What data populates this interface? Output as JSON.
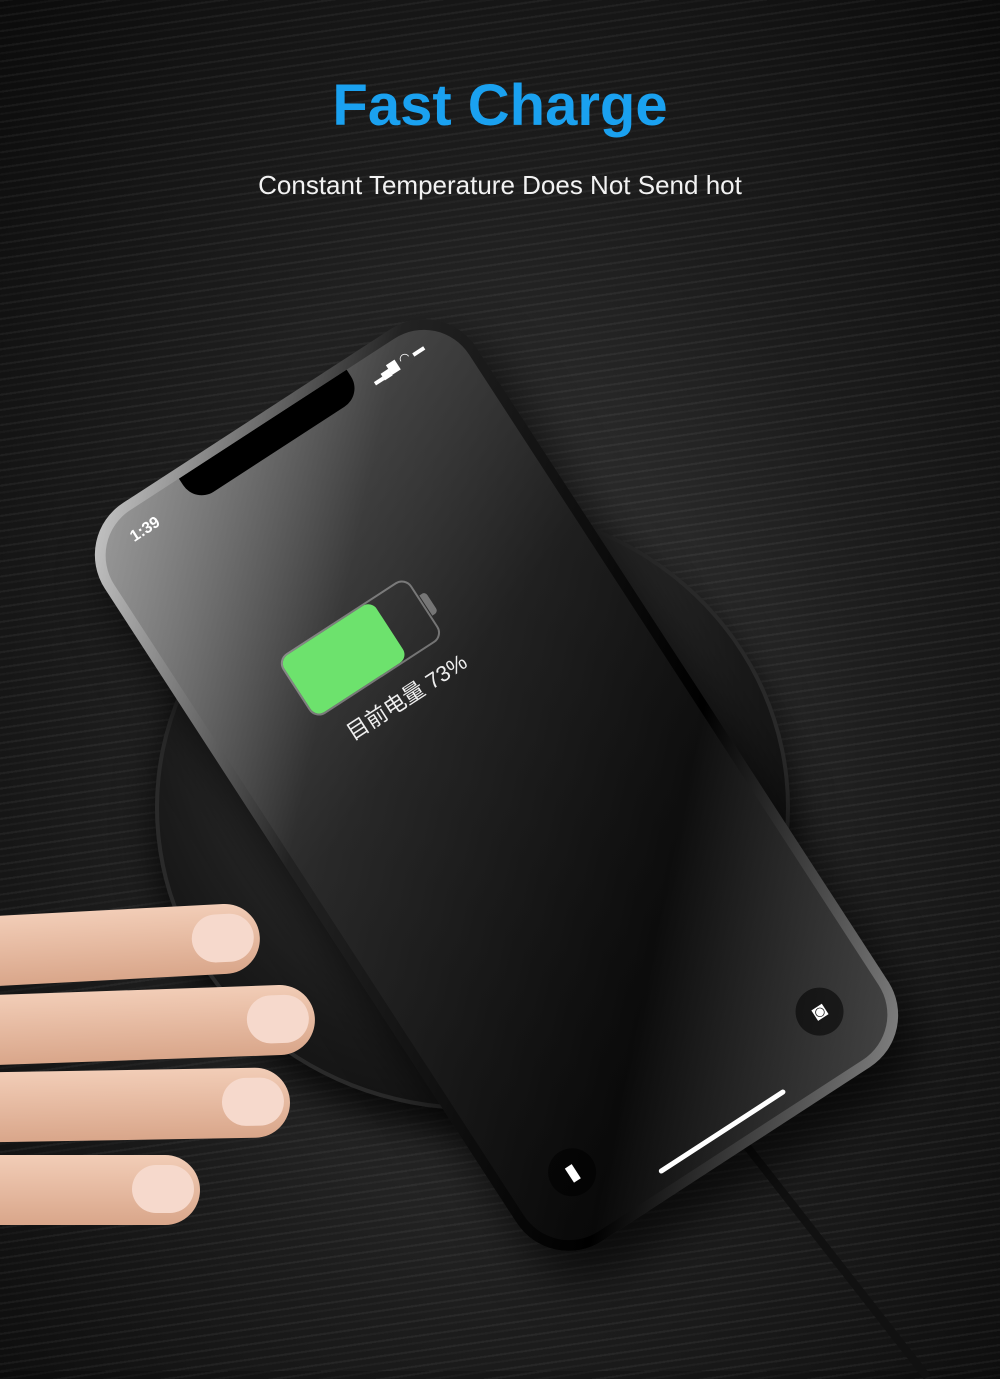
{
  "header": {
    "title": "Fast Charge",
    "subtitle": "Constant Temperature Does Not Send hot"
  },
  "phone": {
    "time": "1:39",
    "status_icons": "signal-wifi-battery",
    "battery_percent": 73,
    "charge_text": "目前电量 73%",
    "battery_color": "#6de26d",
    "flashlight_icon": "flashlight-icon",
    "camera_icon": "camera-icon"
  },
  "colors": {
    "title": "#1aa1f0"
  }
}
